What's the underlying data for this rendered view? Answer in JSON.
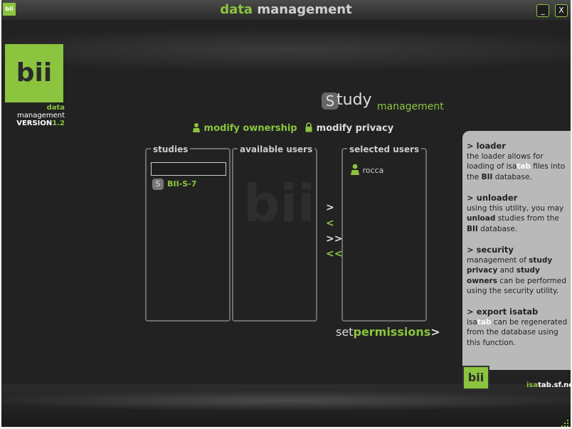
{
  "window": {
    "app_icon": "bii",
    "title_part1": "data",
    "title_part2": "management",
    "minimize_label": "_",
    "close_label": "X"
  },
  "logo": {
    "mark": "bii",
    "line1_green": "data",
    "line1_rest": " management",
    "version_label": "VERSION",
    "version_number": "1.2"
  },
  "header": {
    "study_initial": "S",
    "study_rest": "tudy",
    "study_sub": "management"
  },
  "modes": {
    "ownership": "modify ownership",
    "privacy": "modify privacy"
  },
  "panels": {
    "studies": {
      "title": "studies",
      "search_value": "",
      "items": [
        {
          "chip": "S",
          "label": "BII-S-7"
        }
      ]
    },
    "available": {
      "title": "available users",
      "watermark": "bii"
    },
    "selected": {
      "title": "selected users",
      "users": [
        {
          "name": "rocca"
        }
      ]
    }
  },
  "arrows": {
    "add_one": ">",
    "remove_one": "<",
    "add_all": ">>",
    "remove_all": "<<"
  },
  "action": {
    "set": "set",
    "permissions": "permissions",
    "chevron": ">"
  },
  "info": {
    "loader": {
      "heading": "> loader",
      "t1": "the loader allows for loading of ",
      "isa": "isa",
      "tab": "tab",
      "t2": " files into the ",
      "bii": "BII",
      "t3": " database."
    },
    "unloader": {
      "heading": "> unloader",
      "t1": "using this utility, you may ",
      "unload": "unload",
      "t2": " studies from the ",
      "bii": "BII",
      "t3": " database."
    },
    "security": {
      "heading": "> security",
      "t1": "management of ",
      "study_privacy": "study privacy",
      "t2": " and ",
      "study_owners": "study owners",
      "t3": " can be performed using the security utility."
    },
    "export": {
      "heading": "> export isatab",
      "isa": "isa",
      "tab": "tab",
      "t1": " can be regenerated from the database using this function."
    }
  },
  "footer": {
    "logo": "bii",
    "link_isa": "isa",
    "link_rest": "tab.sf.net"
  },
  "colors": {
    "accent": "#8bc43f",
    "background": "#222222",
    "info_panel": "#b9b9b9"
  }
}
